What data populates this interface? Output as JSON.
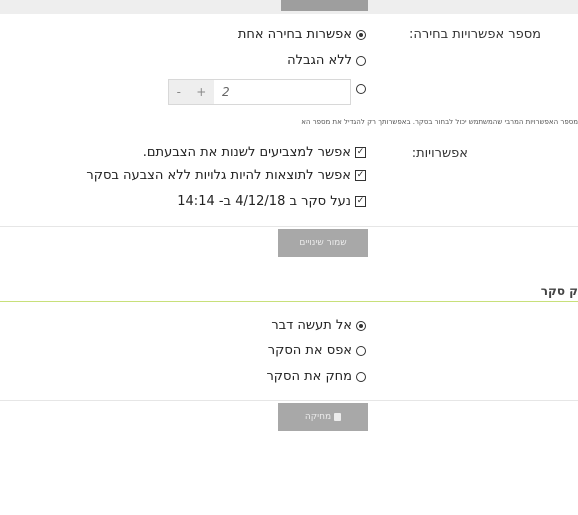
{
  "question_count": {
    "label": "מספר אפשרויות בחירה:",
    "single_option": "אפשרות בחירה אחת",
    "unlimited_option": "ללא הגבלה",
    "stepper_value": "2",
    "stepper_minus": "-",
    "stepper_plus": "+",
    "hint": "מספר האפשרויות המרבי שהמשתמש יכול לבחור בסקר. באפשרותך רק להגדיל את מספר הא"
  },
  "options": {
    "label": "אפשרויות:",
    "allow_change": "אפשר למצביעים לשנות את הצבעתם.",
    "results_visible": "אפשר לתוצאות להיות גלויות ללא הצבעה בסקר",
    "close_poll": "נעל סקר ב 4/12/18 ב- 14:14"
  },
  "save_button": {
    "label": "שמור שינויים"
  },
  "delete_section": {
    "title": "ק סקר",
    "do_nothing": "אל תעשה דבר",
    "reset_poll": "אפס את הסקר",
    "delete_poll": "מחק את הסקר"
  },
  "delete_button": {
    "label": "מחיקה"
  },
  "icons": {
    "check": "check-icon",
    "trash": "trash-icon"
  }
}
